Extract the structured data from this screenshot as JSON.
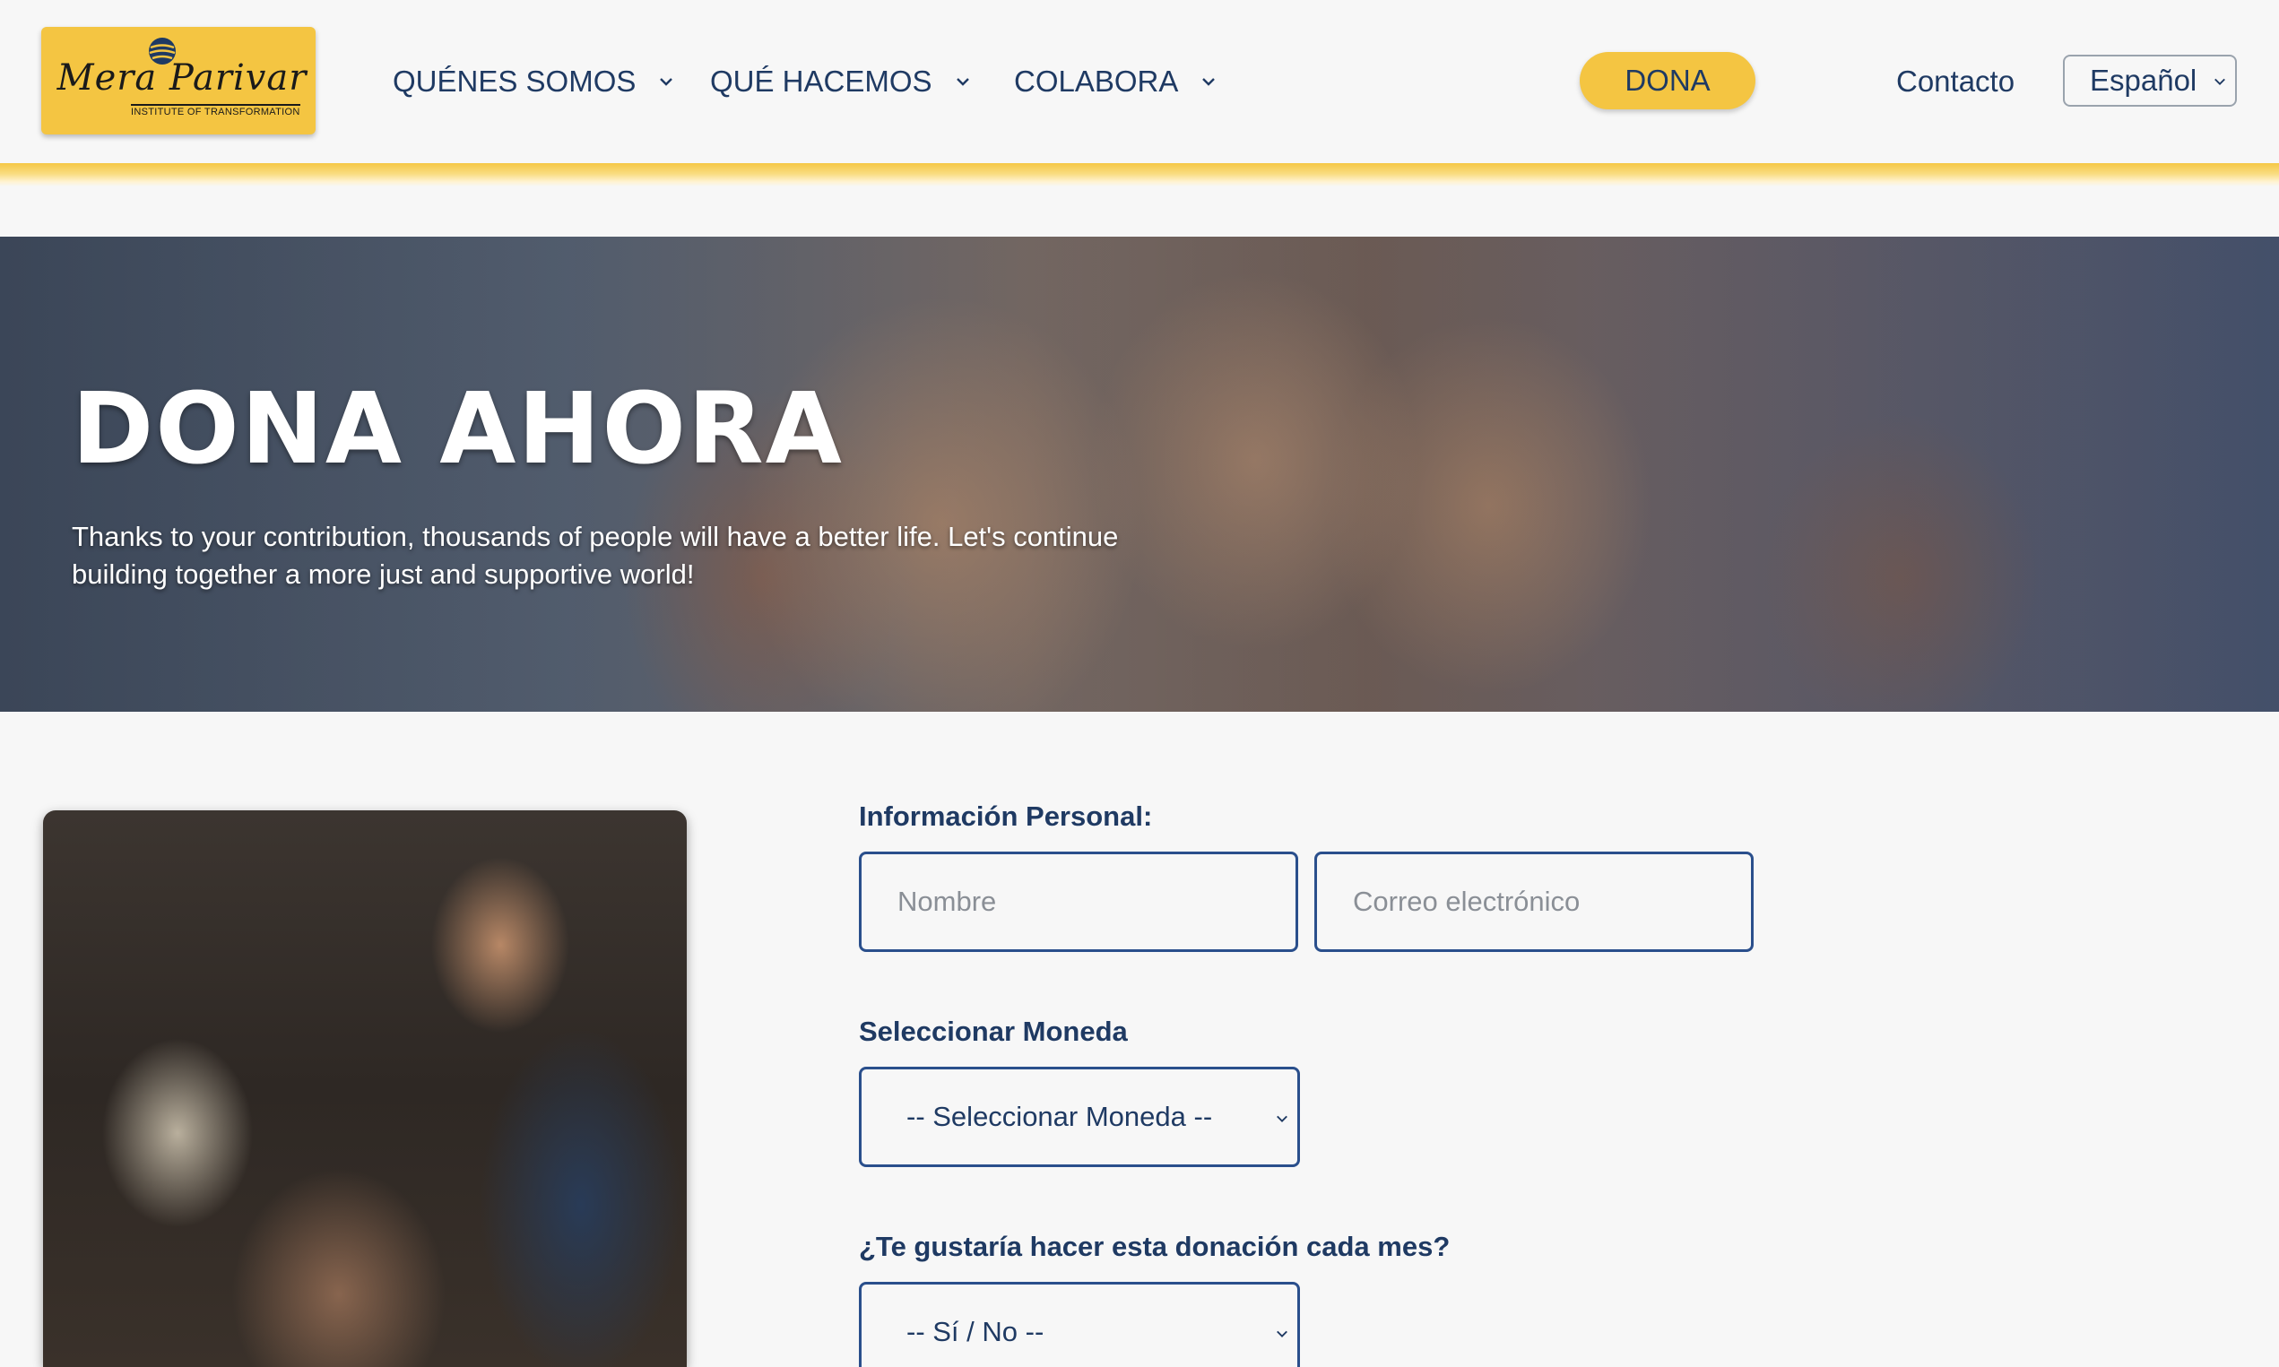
{
  "header": {
    "logo": {
      "name": "Mera Parivar",
      "tagline": "INSTITUTE OF TRANSFORMATION"
    },
    "nav": [
      {
        "label": "QUÉNES SOMOS"
      },
      {
        "label": "QUÉ HACEMOS"
      },
      {
        "label": "COLABORA"
      }
    ],
    "donate_label": "DONA",
    "contact_label": "Contacto",
    "language": "Español"
  },
  "hero": {
    "title": "DONA AHORA",
    "subtitle": "Thanks to your contribution, thousands of people will have a better life. Let's continue building together a more just and supportive world!"
  },
  "form": {
    "personal_info_label": "Información Personal:",
    "name_placeholder": "Nombre",
    "email_placeholder": "Correo electrónico",
    "currency_label": "Seleccionar Moneda",
    "currency_selected": "-- Seleccionar Moneda --",
    "monthly_label": "¿Te gustaría hacer esta donación cada mes?",
    "monthly_selected": "-- Sí / No --"
  },
  "colors": {
    "accent": "#f4c542",
    "navy": "#1f3a63",
    "input_border": "#2a4f8c",
    "background": "#f7f7f7"
  }
}
